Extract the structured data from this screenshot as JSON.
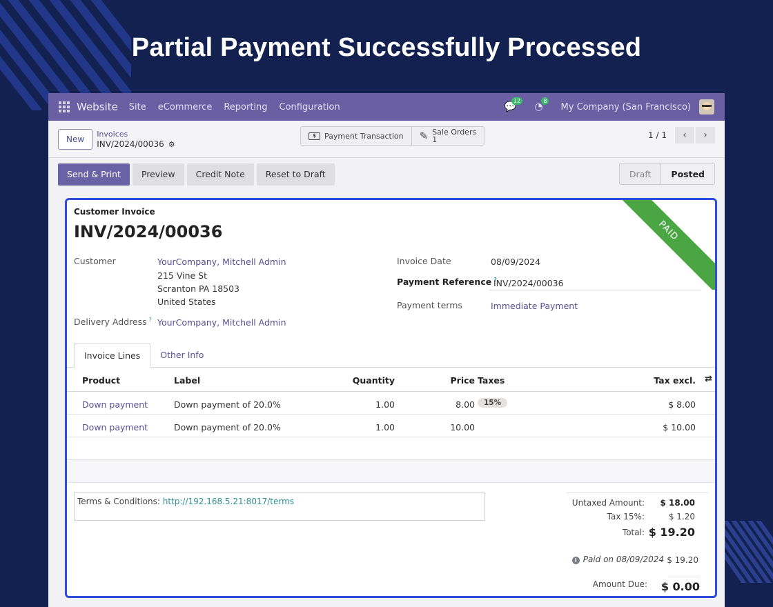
{
  "banner": {
    "title": "Partial Payment Successfully Processed"
  },
  "topnav": {
    "app": "Website",
    "items": [
      "Site",
      "eCommerce",
      "Reporting",
      "Configuration"
    ],
    "messages_count": "12",
    "activities_count": "8",
    "company": "My Company (San Francisco)"
  },
  "control_panel": {
    "new_label": "New",
    "breadcrumb_parent": "Invoices",
    "breadcrumb_current": "INV/2024/00036",
    "smart_buttons": {
      "payment_transaction": "Payment Transaction",
      "sale_orders_label": "Sale Orders",
      "sale_orders_count": "1"
    },
    "pager": "1 / 1"
  },
  "actions": {
    "send_print": "Send & Print",
    "preview": "Preview",
    "credit_note": "Credit Note",
    "reset_to_draft": "Reset to Draft"
  },
  "statusbar": {
    "draft": "Draft",
    "posted": "Posted"
  },
  "invoice": {
    "ribbon": "PAID",
    "type_label": "Customer Invoice",
    "number": "INV/2024/00036",
    "customer_label": "Customer",
    "customer_name": "YourCompany, Mitchell Admin",
    "address_line1": "215 Vine St",
    "address_line2": "Scranton PA 18503",
    "address_line3": "United States",
    "delivery_label": "Delivery Address",
    "delivery_value": "YourCompany, Mitchell Admin",
    "invoice_date_label": "Invoice Date",
    "invoice_date": "08/09/2024",
    "payment_ref_label": "Payment Reference",
    "payment_ref": "INV/2024/00036",
    "payment_terms_label": "Payment terms",
    "payment_terms": "Immediate Payment",
    "help_mark": "?"
  },
  "tabs": {
    "invoice_lines": "Invoice Lines",
    "other_info": "Other Info"
  },
  "lines": {
    "headers": {
      "product": "Product",
      "label": "Label",
      "quantity": "Quantity",
      "price": "Price",
      "taxes": "Taxes",
      "tax_excl": "Tax excl."
    },
    "rows": [
      {
        "product": "Down payment",
        "label": "Down payment of 20.0%",
        "quantity": "1.00",
        "price": "8.00",
        "taxes": "15%",
        "subtotal": "$ 8.00"
      },
      {
        "product": "Down payment",
        "label": "Down payment of 20.0%",
        "quantity": "1.00",
        "price": "10.00",
        "taxes": "",
        "subtotal": "$ 10.00"
      }
    ]
  },
  "terms": {
    "label": "Terms & Conditions:",
    "url": "http://192.168.5.21:8017/terms"
  },
  "totals": {
    "untaxed_label": "Untaxed Amount:",
    "untaxed": "$ 18.00",
    "tax_label": "Tax 15%:",
    "tax": "$ 1.20",
    "total_label": "Total:",
    "total": "$ 19.20",
    "paid_note": "Paid on 08/09/2024",
    "paid_amount": "$ 19.20",
    "amount_due_label": "Amount Due:",
    "amount_due": "$ 0.00"
  },
  "colors": {
    "navbar": "#6a5fa3",
    "primary": "#6b62a6",
    "highlight_border": "#2f4ddb",
    "paid_ribbon": "#49a642",
    "background": "#12214f"
  }
}
